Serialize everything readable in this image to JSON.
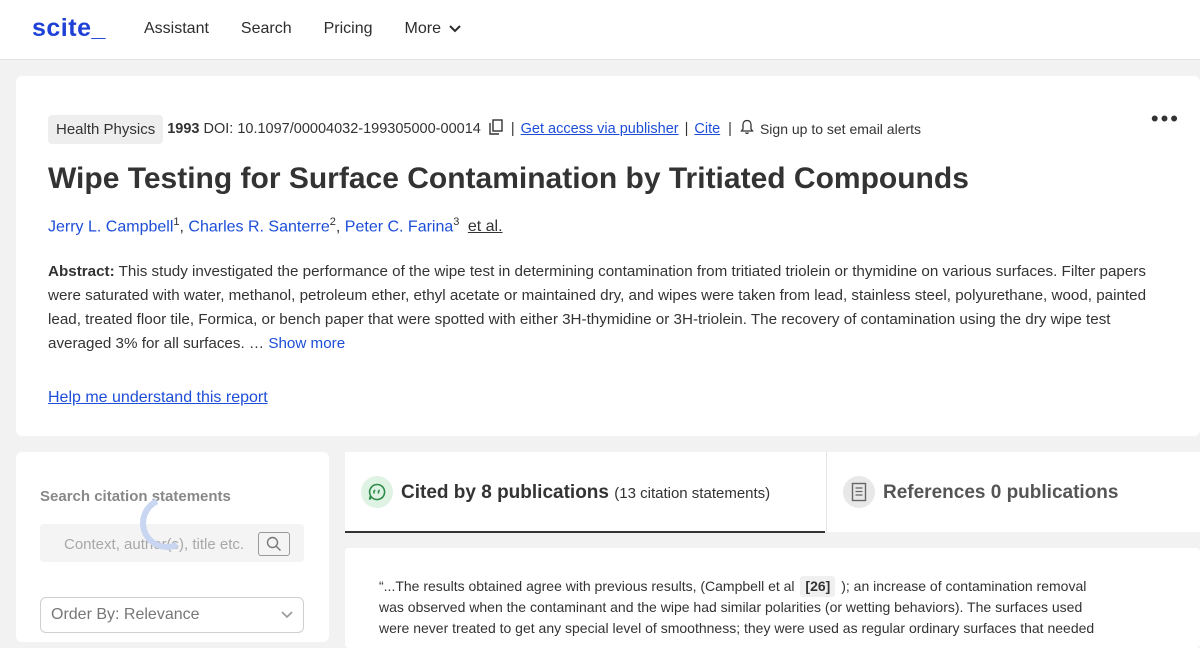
{
  "header": {
    "logo": "scite_",
    "nav": {
      "assistant": "Assistant",
      "search": "Search",
      "pricing": "Pricing",
      "more": "More"
    }
  },
  "paper": {
    "journal": "Health Physics",
    "year": "1993",
    "doi": "DOI: 10.1097/00004032-199305000-00014",
    "access_link": "Get access via publisher",
    "cite_link": "Cite",
    "alerts": "Sign up to set email alerts",
    "title": "Wipe Testing for Surface Contamination by Tritiated Compounds",
    "authors": [
      {
        "name": "Jerry L. Campbell",
        "sup": "1"
      },
      {
        "name": "Charles R. Santerre",
        "sup": "2"
      },
      {
        "name": "Peter C. Farina",
        "sup": "3"
      }
    ],
    "et_al": "et al.",
    "abstract_label": "Abstract:",
    "abstract_text": "This study investigated the performance of the wipe test in determining contamination from tritiated triolein or thymidine on various surfaces. Filter papers were saturated with water, methanol, petroleum ether, ethyl acetate or maintained dry, and wipes were taken from lead, stainless steel, polyurethane, wood, painted lead, treated floor tile, Formica, or bench paper that were spotted with either 3H-thymidine or 3H-triolein. The recovery of contamination using the dry wipe test averaged 3% for all surfaces. …",
    "show_more": "Show more",
    "help_link": "Help me understand this report"
  },
  "search_panel": {
    "title": "Search citation statements",
    "placeholder": "Context, author(s), title etc.",
    "order_by": "Order By: Relevance"
  },
  "tabs": {
    "cited_label": "Cited by 8 publications",
    "cited_sub": "(13 citation statements)",
    "refs_label": "References 0 publications"
  },
  "statement": {
    "text_before": "“...The results obtained agree with previous results, (Campbell et al",
    "ref": "[26]",
    "text_after": "); an increase of contamination removal was observed when the contaminant and the wipe had similar polarities (or wetting behaviors). The surfaces used were never treated to get any special level of smoothness; they were used as regular ordinary surfaces that needed"
  },
  "colors": {
    "brand": "#1e40d6",
    "link": "#1d4ed8",
    "background": "#f2f2f2"
  }
}
